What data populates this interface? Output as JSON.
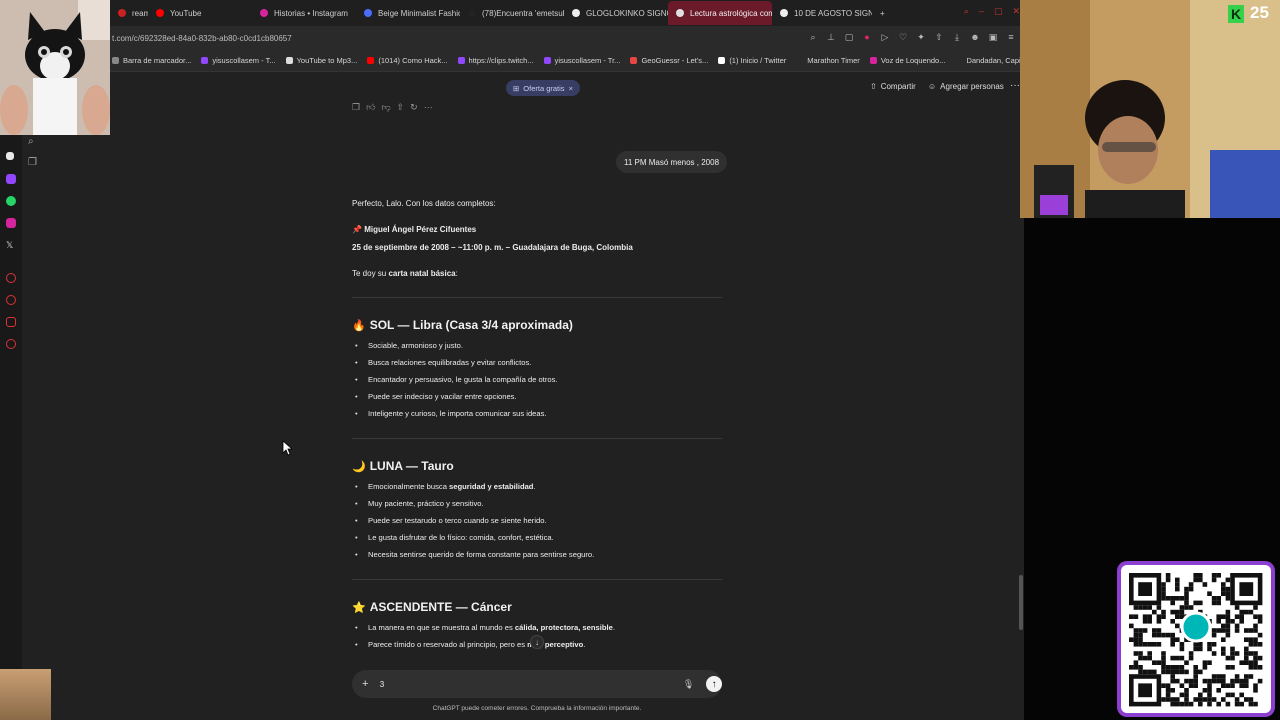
{
  "browser": {
    "tabs": [
      {
        "label": "ream - Y",
        "color": "#cc2222"
      },
      {
        "label": "YouTube",
        "color": "#ff0000"
      },
      {
        "label": "Historias • Instagram",
        "color": "#d6249f"
      },
      {
        "label": "Beige Minimalist Fashion",
        "color": "#4a6cff"
      },
      {
        "label": "(78)Encuentra 'emetsuk",
        "color": "#222222"
      },
      {
        "label": "GLOGLOKINKO SIGNO -",
        "color": "#eeeeee"
      },
      {
        "label": "Lectura astrológica com",
        "color": "#e0e0e0"
      },
      {
        "label": "10 DE AGOSTO SIGNO -",
        "color": "#eeeeee"
      }
    ],
    "new_tab": "+",
    "url": "t.com/c/692328ed-84a0-832b-ab80-c0cd1cb80657",
    "bookmarks": [
      {
        "label": "Barra de marcador...",
        "color": "#888888"
      },
      {
        "label": "yisuscollasem - T...",
        "color": "#9146ff"
      },
      {
        "label": "YouTube to Mp3...",
        "color": "#dddddd"
      },
      {
        "label": "(1014) Como Hack...",
        "color": "#ff0000"
      },
      {
        "label": "https://clips.twitch...",
        "color": "#9146ff"
      },
      {
        "label": "yisuscollasem - Tr...",
        "color": "#9146ff"
      },
      {
        "label": "GeoGuessr - Let's...",
        "color": "#e84545"
      },
      {
        "label": "(1) Inicio / Twitter",
        "color": "#ffffff"
      },
      {
        "label": "Marathon Timer",
        "color": "#2a2a2a"
      },
      {
        "label": "Voz de Loquendo...",
        "color": "#d6249f"
      },
      {
        "label": "Dandadan, Capitul...",
        "color": "#2a2a2a"
      }
    ]
  },
  "chat": {
    "offer_label": "Oferta gratis",
    "offer_close": "×",
    "share_label": "Compartir",
    "people_label": "Agregar personas",
    "more_label": "···",
    "user_message": "11 PM Masó menos , 2008",
    "intro_line": "Perfecto, Lalo. Con los datos completos:",
    "pin": "📌",
    "name_line": "Miguel Ángel Pérez Cifuentes",
    "birth_line": "25 de septiembre de 2008 – ~11:00 p. m. – Guadalajara de Buga, Colombia",
    "chart_intro_prefix": "Te doy su ",
    "chart_intro_bold": "carta natal básica",
    "chart_intro_suffix": ":",
    "sections": [
      {
        "emoji": "🔥",
        "title": "SOL — Libra (Casa 3/4 aproximada)",
        "items": [
          {
            "pre": "Sociable, armonioso y justo.",
            "bold": "",
            "post": ""
          },
          {
            "pre": "Busca relaciones equilibradas y evitar conflictos.",
            "bold": "",
            "post": ""
          },
          {
            "pre": "Encantador y persuasivo, le gusta la compañía de otros.",
            "bold": "",
            "post": ""
          },
          {
            "pre": "Puede ser indeciso y vacilar entre opciones.",
            "bold": "",
            "post": ""
          },
          {
            "pre": "Inteligente y curioso, le importa comunicar sus ideas.",
            "bold": "",
            "post": ""
          }
        ]
      },
      {
        "emoji": "🌙",
        "title": "LUNA — Tauro",
        "items": [
          {
            "pre": "Emocionalmente busca ",
            "bold": "seguridad y estabilidad",
            "post": "."
          },
          {
            "pre": "Muy paciente, práctico y sensitivo.",
            "bold": "",
            "post": ""
          },
          {
            "pre": "Puede ser testarudo o terco cuando se siente herido.",
            "bold": "",
            "post": ""
          },
          {
            "pre": "Le gusta disfrutar de lo físico: comida, confort, estética.",
            "bold": "",
            "post": ""
          },
          {
            "pre": "Necesita sentirse querido de forma constante para sentirse seguro.",
            "bold": "",
            "post": ""
          }
        ]
      },
      {
        "emoji": "⭐",
        "title": "ASCENDENTE — Cáncer",
        "items": [
          {
            "pre": "La manera en que se muestra al mundo es ",
            "bold": "cálida, protectora, sensible",
            "post": "."
          },
          {
            "pre": "Parece tímido o reservado al principio, pero es ",
            "bold": "muy perceptivo",
            "post": "."
          }
        ]
      }
    ],
    "composer_value": "3",
    "disclaimer": "ChatGPT puede cometer errores. Comprueba la información importante."
  },
  "overlay": {
    "counter_logo": "K",
    "counter_value": "25"
  },
  "colors": {
    "background": "#212121",
    "active_tab": "#6b1a2a",
    "offer_pill": "#373d63",
    "qr_frame": "#8c3fd0",
    "counter_green": "#36d14b"
  }
}
